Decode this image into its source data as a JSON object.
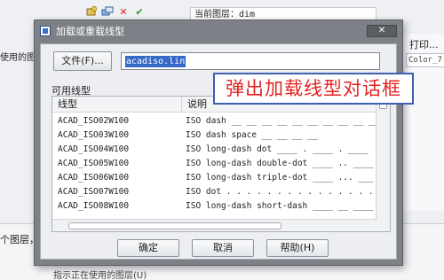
{
  "background": {
    "current_layer_label": "当前图层：dim",
    "used_layers_text": "使用的图层",
    "print_label": "打印...",
    "color_value": "Color_7",
    "bottom_text": "个图层，",
    "bottom_text2": "指示正在使用的图层(U)"
  },
  "dialog": {
    "title": "加载或重载线型",
    "file_button_label": "文件(F)...",
    "file_value": "acadiso.lin",
    "available_label": "可用线型",
    "columns": [
      "线型",
      "说明"
    ],
    "rows": [
      {
        "name": "ACAD_ISO02W100",
        "desc": "ISO dash __ __ __ __ __ __ __ __ __ __"
      },
      {
        "name": "ACAD_ISO03W100",
        "desc": "ISO dash space __    __    __    __"
      },
      {
        "name": "ACAD_ISO04W100",
        "desc": "ISO long-dash dot ____ . ____ . ____"
      },
      {
        "name": "ACAD_ISO05W100",
        "desc": "ISO long-dash double-dot ____ .. ____"
      },
      {
        "name": "ACAD_ISO06W100",
        "desc": "ISO long-dash triple-dot ____ ... ___"
      },
      {
        "name": "ACAD_ISO07W100",
        "desc": "ISO dot . . . . . . . . . . . . . . ."
      },
      {
        "name": "ACAD_ISO08W100",
        "desc": "ISO long-dash short-dash ____ __ ____"
      }
    ],
    "ok_label": "确定",
    "cancel_label": "取消",
    "help_label": "帮助(H)"
  },
  "annotation": {
    "text": "弹出加载线型对话框"
  },
  "colors": {
    "callout_text": "#e52222",
    "callout_border": "#3d5fb0",
    "selection": "#3468c9"
  }
}
